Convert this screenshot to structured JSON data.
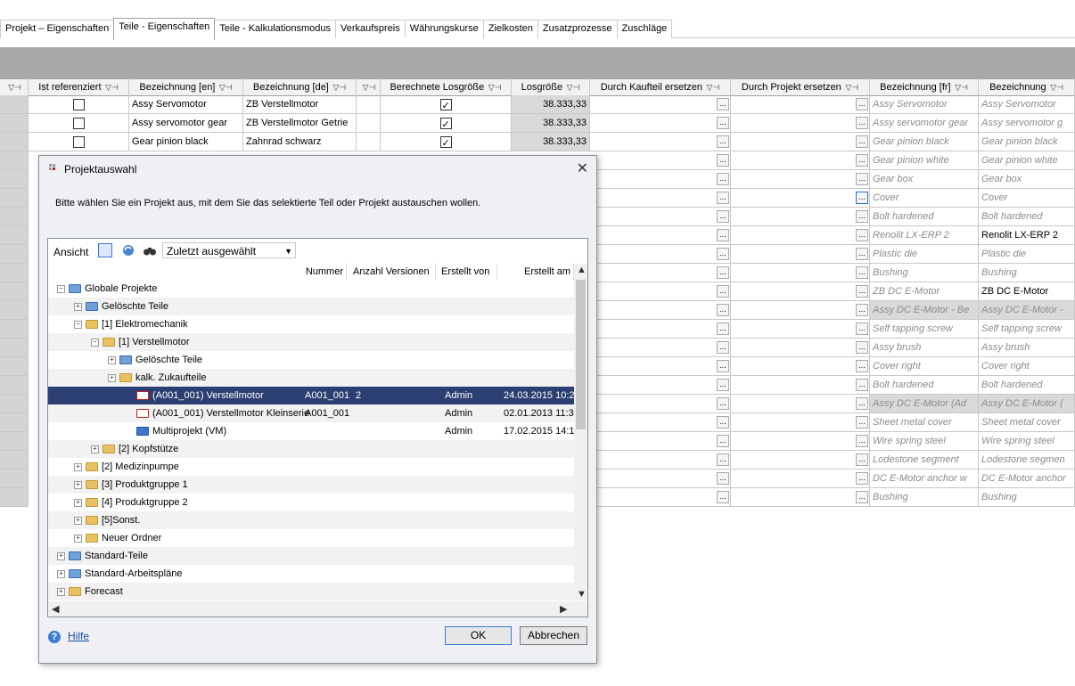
{
  "tabs": [
    "Projekt – Eigenschaften",
    "Teile - Eigenschaften",
    "Teile - Kalkulationsmodus",
    "Verkaufspreis",
    "Währungskurse",
    "Zielkosten",
    "Zusatzprozesse",
    "Zuschläge"
  ],
  "active_tab": "Teile - Eigenschaften",
  "grid": {
    "headers": {
      "referenced": "Ist referenziert",
      "name_en": "Bezeichnung [en]",
      "name_de": "Bezeichnung [de]",
      "calc_lot": "Berechnete Losgröße",
      "lot": "Losgröße",
      "replace_part": "Durch Kaufteil ersetzen",
      "replace_project": "Durch Projekt ersetzen",
      "name_fr": "Bezeichnung [fr]",
      "name": "Bezeichnung"
    },
    "top_rows": [
      {
        "en": "Assy Servomotor",
        "de": "ZB Verstellmotor",
        "lot": "38.333,33",
        "checked": true
      },
      {
        "en": "Assy servomotor gear",
        "de": "ZB Verstellmotor Getrie",
        "lot": "38.333,33",
        "checked": true
      },
      {
        "en": "Gear pinion black",
        "de": "Zahnrad schwarz",
        "lot": "38.333,33",
        "checked": true
      }
    ],
    "fr_col": [
      "Assy Servomotor",
      "Assy servomotor gear",
      "Gear pinion black",
      "Gear pinion white",
      "Gear box",
      "Cover",
      "Bolt hardened",
      "Renolit LX-ERP 2",
      "Plastic die",
      "Bushing",
      "ZB DC E-Motor",
      "Assy DC E-Motor - Be",
      "Self tapping screw",
      "Assy brush",
      "Cover right",
      "Bolt hardened",
      "Assy DC E-Motor (Ad",
      "Sheet metal cover",
      "Wire spring steel",
      "Lodestone segment",
      "DC E-Motor anchor w",
      "Bushing"
    ],
    "name_col": [
      "Assy Servomotor",
      "Assy servomotor g",
      "Gear pinion black",
      "Gear pinion white",
      "Gear box",
      "Cover",
      "Bolt hardened",
      "Renolit LX-ERP 2",
      "Plastic die",
      "Bushing",
      "ZB DC E-Motor",
      "Assy DC E-Motor -",
      "Self tapping screw",
      "Assy brush",
      "Cover right",
      "Bolt hardened",
      "Assy DC E-Motor (",
      "Sheet metal cover",
      "Wire spring steel",
      "Lodestone segmen",
      "DC E-Motor anchor",
      "Bushing"
    ],
    "dots": "..."
  },
  "dialog": {
    "title": "Projektauswahl",
    "message": "Bitte wählen Sie ein Projekt aus, mit dem Sie das selektierte Teil oder Projekt austauschen wollen.",
    "view_label": "Ansicht",
    "combo_value": "Zuletzt ausgewählt",
    "columns": {
      "number": "Nummer",
      "versions": "Anzahl Versionen",
      "created_by": "Erstellt von",
      "created_at": "Erstellt am"
    },
    "tree": [
      {
        "label": "Globale Projekte",
        "depth": 0,
        "exp": "minus",
        "icon": "glob"
      },
      {
        "label": "Gelöschte Teile",
        "depth": 1,
        "exp": "plus",
        "icon": "glob"
      },
      {
        "label": "[1] Elektromechanik",
        "depth": 1,
        "exp": "minus",
        "icon": "folder"
      },
      {
        "label": "[1] Verstellmotor",
        "depth": 2,
        "exp": "minus",
        "icon": "folder"
      },
      {
        "label": "Gelöschte Teile",
        "depth": 3,
        "exp": "plus",
        "icon": "glob"
      },
      {
        "label": "kalk. Zukaufteile",
        "depth": 3,
        "exp": "plus",
        "icon": "folder"
      },
      {
        "label": "(A001_001) Verstellmotor",
        "depth": 4,
        "exp": "",
        "icon": "red",
        "number": "A001_001",
        "versions": "2",
        "by": "Admin",
        "at": "24.03.2015 10:2",
        "selected": true
      },
      {
        "label": "(A001_001) Verstellmotor Kleinserie",
        "depth": 4,
        "exp": "",
        "icon": "red",
        "number": "A001_001",
        "versions": "",
        "by": "Admin",
        "at": "02.01.2013 11:3"
      },
      {
        "label": "Multiprojekt (VM)",
        "depth": 4,
        "exp": "",
        "icon": "blue",
        "number": "",
        "versions": "",
        "by": "Admin",
        "at": "17.02.2015 14:1"
      },
      {
        "label": "[2] Kopfstütze",
        "depth": 2,
        "exp": "plus",
        "icon": "folder"
      },
      {
        "label": "[2] Medizinpumpe",
        "depth": 1,
        "exp": "plus",
        "icon": "folder"
      },
      {
        "label": "[3] Produktgruppe 1",
        "depth": 1,
        "exp": "plus",
        "icon": "folder"
      },
      {
        "label": "[4] Produktgruppe 2",
        "depth": 1,
        "exp": "plus",
        "icon": "folder"
      },
      {
        "label": "[5]Sonst.",
        "depth": 1,
        "exp": "plus",
        "icon": "folder"
      },
      {
        "label": "Neuer Ordner",
        "depth": 1,
        "exp": "plus",
        "icon": "folder"
      },
      {
        "label": "Standard-Teile",
        "depth": 0,
        "exp": "plus",
        "icon": "glob"
      },
      {
        "label": "Standard-Arbeitspläne",
        "depth": 0,
        "exp": "plus",
        "icon": "glob"
      },
      {
        "label": "Forecast",
        "depth": 0,
        "exp": "plus",
        "icon": "folder"
      }
    ],
    "help": "Hilfe",
    "ok": "OK",
    "cancel": "Abbrechen"
  }
}
